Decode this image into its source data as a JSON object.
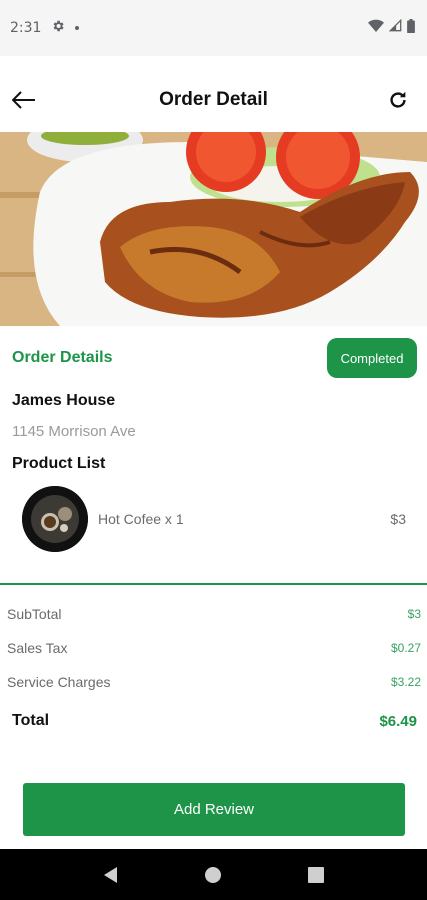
{
  "status_bar": {
    "time": "2:31",
    "icons": [
      "gear-icon",
      "notification-dot-icon",
      "wifi-icon",
      "signal-icon",
      "battery-icon"
    ]
  },
  "app_bar": {
    "title": "Order Detail",
    "back_icon": "arrow-left-icon",
    "refresh_icon": "refresh-icon"
  },
  "order": {
    "section_title": "Order Details",
    "status": "Completed",
    "restaurant_name": "James House",
    "restaurant_address": "1145 Morrison Ave",
    "product_list_title": "Product List",
    "products": [
      {
        "name": "Hot Cofee x 1",
        "price": "$3"
      }
    ]
  },
  "summary": {
    "rows": [
      {
        "label": "SubTotal",
        "value": "$3"
      },
      {
        "label": "Sales Tax",
        "value": "$0.27"
      },
      {
        "label": "Service Charges",
        "value": "$3.22"
      }
    ],
    "total_label": "Total",
    "total_value": "$6.49"
  },
  "actions": {
    "add_review_label": "Add Review"
  },
  "colors": {
    "accent": "#1e9448",
    "muted_text": "#9a9a9a"
  },
  "nav": {
    "icons": [
      "back-triangle-icon",
      "home-circle-icon",
      "recents-square-icon"
    ]
  }
}
